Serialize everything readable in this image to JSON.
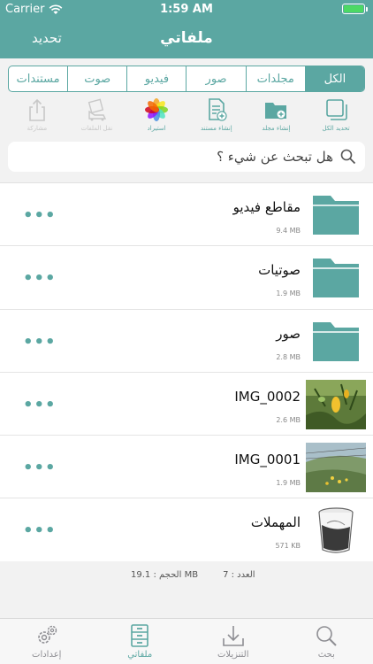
{
  "status_bar": {
    "carrier": "Carrier",
    "time": "1:59 AM"
  },
  "nav": {
    "title": "ملفاتي",
    "refresh_label": "تحديد"
  },
  "segments": [
    {
      "label": "الكل",
      "active": true
    },
    {
      "label": "مجلدات",
      "active": false
    },
    {
      "label": "صور",
      "active": false
    },
    {
      "label": "فيديو",
      "active": false
    },
    {
      "label": "صوت",
      "active": false
    },
    {
      "label": "مستندات",
      "active": false
    }
  ],
  "toolbar": {
    "select_all": "تحديد الكل",
    "new_folder": "إنشاء مجلد",
    "new_document": "إنشاء مستند",
    "import": "استيراد",
    "move_files": "نقل الملفات",
    "share": "مشاركة"
  },
  "search": {
    "placeholder": "هل تبحث عن شيء ؟"
  },
  "files": [
    {
      "name": "مقاطع فيديو",
      "size": "9.4 MB",
      "kind": "folder-icon"
    },
    {
      "name": "صوتيات",
      "size": "1.9 MB",
      "kind": "folder-icon"
    },
    {
      "name": "صور",
      "size": "2.8 MB",
      "kind": "folder-icon"
    },
    {
      "name": "IMG_0002",
      "size": "2.6 MB",
      "kind": "photo-thumbnail"
    },
    {
      "name": "IMG_0001",
      "size": "1.9 MB",
      "kind": "photo-thumbnail"
    },
    {
      "name": "المهملات",
      "size": "571 KB",
      "kind": "trash-icon"
    }
  ],
  "more_label": "•••",
  "footer": {
    "count": "العدد : 7",
    "size": "الحجم : 19.1 MB"
  },
  "tabs": [
    {
      "label": "بحث",
      "icon": "search-icon",
      "active": false
    },
    {
      "label": "التنزيلات",
      "icon": "download-icon",
      "active": false
    },
    {
      "label": "ملفاتي",
      "icon": "cabinet-icon",
      "active": true
    },
    {
      "label": "إعدادات",
      "icon": "gear-icon",
      "active": false
    }
  ],
  "colors": {
    "accent": "#5ba7a2",
    "battery": "#4cd964"
  }
}
